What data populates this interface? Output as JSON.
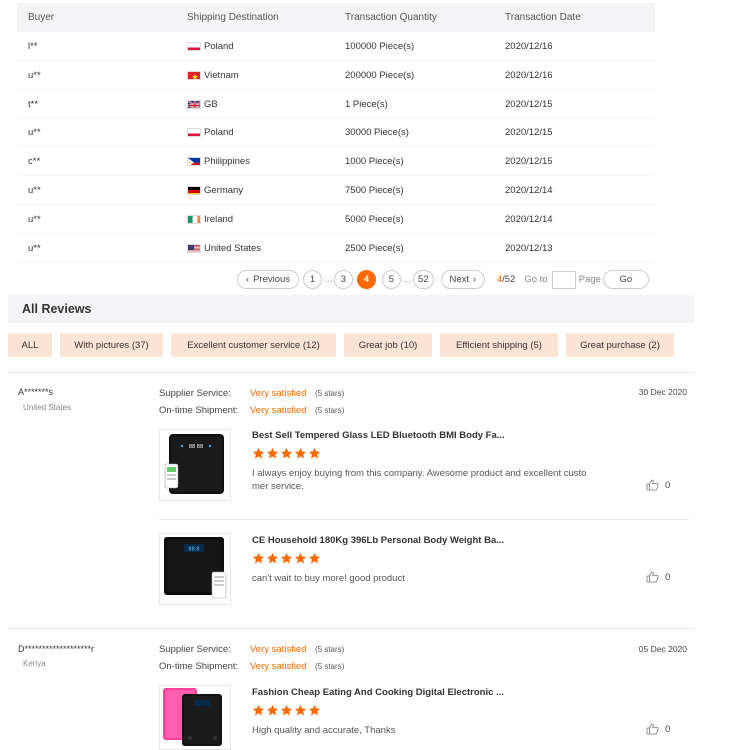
{
  "transactions": {
    "headers": [
      "Buyer",
      "Shipping Destination",
      "Transaction Quantity",
      "Transaction Date"
    ],
    "rows": [
      {
        "buyer": "l**",
        "country": "Poland",
        "flag": "poland",
        "qty": "100000 Piece(s)",
        "date": "2020/12/16"
      },
      {
        "buyer": "u**",
        "country": "Vietnam",
        "flag": "vietnam",
        "qty": "200000 Piece(s)",
        "date": "2020/12/16"
      },
      {
        "buyer": "t**",
        "country": "GB",
        "flag": "gb",
        "qty": "1 Piece(s)",
        "date": "2020/12/15"
      },
      {
        "buyer": "u**",
        "country": "Poland",
        "flag": "poland",
        "qty": "30000 Piece(s)",
        "date": "2020/12/15"
      },
      {
        "buyer": "c**",
        "country": "Philippines",
        "flag": "philippines",
        "qty": "1000 Piece(s)",
        "date": "2020/12/15"
      },
      {
        "buyer": "u**",
        "country": "Germany",
        "flag": "germany",
        "qty": "7500 Piece(s)",
        "date": "2020/12/14"
      },
      {
        "buyer": "u**",
        "country": "Ireland",
        "flag": "ireland",
        "qty": "5000 Piece(s)",
        "date": "2020/12/14"
      },
      {
        "buyer": "u**",
        "country": "United States",
        "flag": "usa",
        "qty": "2500 Piece(s)",
        "date": "2020/12/13"
      }
    ]
  },
  "pagination": {
    "prev_label": "Previous",
    "pages": [
      "1",
      "3",
      "4",
      "5",
      "52"
    ],
    "dots": "...",
    "next_label": "Next",
    "current": "4",
    "total": "/52",
    "goto_label": "Go to",
    "page_label": "Page",
    "go_button": "Go"
  },
  "reviews_section": {
    "title": "All Reviews",
    "filters": [
      "ALL",
      "With pictures (37)",
      "Excellent customer service (12)",
      "Great job (10)",
      "Efficient shipping (5)",
      "Great purchase (2)"
    ]
  },
  "reviews": [
    {
      "user": "A*******s",
      "country": "United States",
      "date": "30 Dec 2020",
      "supplier_label": "Supplier Service:",
      "supplier_value": "Very satisfied",
      "supplier_stars": "(5 stars)",
      "shipment_label": "On-time Shipment:",
      "shipment_value": "Very satisfied",
      "shipment_stars": "(5 stars)",
      "items": [
        {
          "title": "Best Sell Tempered Glass LED Bluetooth BMI Body Fa...",
          "rating": 5,
          "text": "I always enjoy buying from this company. Awesome product and excellent custo\nmer service.",
          "likes": "0"
        },
        {
          "title": "CE Household 180Kg 396Lb Personal Body Weight Ba...",
          "rating": 5,
          "text": "can't wait to buy more! good product",
          "likes": "0"
        }
      ]
    },
    {
      "user": "D*******************r",
      "country": "Kenya",
      "date": "05 Dec 2020",
      "supplier_label": "Supplier Service:",
      "supplier_value": "Very satisfied",
      "supplier_stars": "(5 stars)",
      "shipment_label": "On-time Shipment:",
      "shipment_value": "Very satisfied",
      "shipment_stars": "(5 stars)",
      "items": [
        {
          "title": "Fashion Cheap Eating And Cooking Digital Electronic ...",
          "rating": 5,
          "text": "High quality and accurate, Thanks",
          "likes": "0"
        }
      ]
    }
  ],
  "colors": {
    "accent": "#ff6a00",
    "filter_bg": "#fbe3d6",
    "header_bg": "#f4f4f6"
  }
}
